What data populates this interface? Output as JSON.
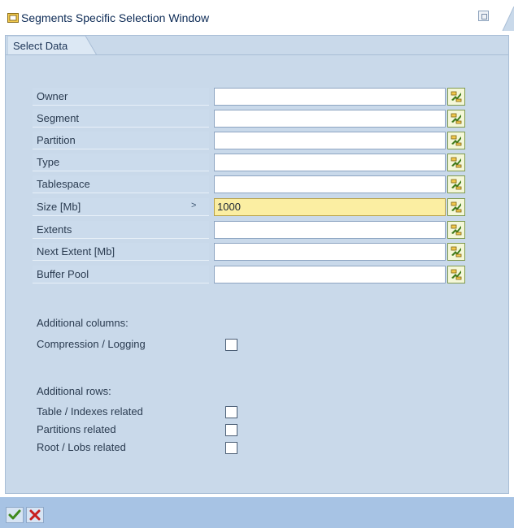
{
  "window": {
    "title": "Segments Specific Selection Window"
  },
  "tabs": {
    "select_data": "Select Data"
  },
  "fields": [
    {
      "label": "Owner",
      "operator": "",
      "value": ""
    },
    {
      "label": "Segment",
      "operator": "",
      "value": ""
    },
    {
      "label": "Partition",
      "operator": "",
      "value": ""
    },
    {
      "label": "Type",
      "operator": "",
      "value": ""
    },
    {
      "label": "Tablespace",
      "operator": "",
      "value": ""
    },
    {
      "label": "Size [Mb]",
      "operator": ">",
      "value": "1000"
    },
    {
      "label": "Extents",
      "operator": "",
      "value": ""
    },
    {
      "label": "Next Extent [Mb]",
      "operator": "",
      "value": ""
    },
    {
      "label": "Buffer Pool",
      "operator": "",
      "value": ""
    }
  ],
  "additional_columns": {
    "heading": "Additional columns:",
    "options": [
      {
        "label": "Compression / Logging",
        "checked": false
      }
    ]
  },
  "additional_rows": {
    "heading": "Additional rows:",
    "options": [
      {
        "label": "Table / Indexes related",
        "checked": false
      },
      {
        "label": "Partitions related",
        "checked": false
      },
      {
        "label": "Root / Lobs related",
        "checked": false
      }
    ]
  },
  "icons": {
    "multiple_selection": "multiple-selection-icon",
    "confirm": "checkmark-icon",
    "cancel": "cross-icon"
  },
  "colors": {
    "panel": "#c9d9ea",
    "focused_input": "#fbeea2",
    "footer": "#a7c3e4",
    "confirm_green": "#3f8a1e",
    "cancel_red": "#c81e1e"
  }
}
